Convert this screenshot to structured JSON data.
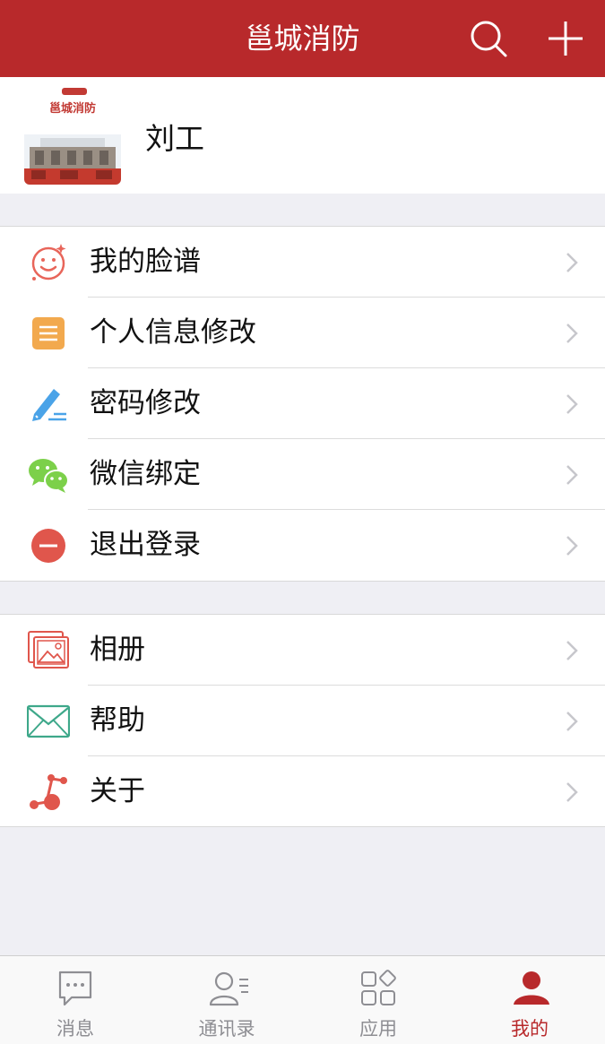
{
  "header": {
    "title": "邕城消防",
    "search_icon": "search-icon",
    "add_icon": "plus-icon",
    "background": "#b8292b"
  },
  "profile": {
    "avatar_label": "邕城消防",
    "name": "刘工"
  },
  "menu_group_1": [
    {
      "label": "我的脸谱",
      "icon": "smiley-face-icon",
      "color": "#e8655a"
    },
    {
      "label": "个人信息修改",
      "icon": "document-icon",
      "color": "#f2a94e"
    },
    {
      "label": "密码修改",
      "icon": "pencil-icon",
      "color": "#4aa3e8"
    },
    {
      "label": "微信绑定",
      "icon": "wechat-icon",
      "color": "#7cd04a"
    },
    {
      "label": "退出登录",
      "icon": "minus-circle-icon",
      "color": "#e0564c"
    }
  ],
  "menu_group_2": [
    {
      "label": "相册",
      "icon": "photo-album-icon",
      "color": "#e0564c"
    },
    {
      "label": "帮助",
      "icon": "envelope-icon",
      "color": "#3ea88a"
    },
    {
      "label": "关于",
      "icon": "share-nodes-icon",
      "color": "#e0564c"
    }
  ],
  "tabbar": {
    "tabs": [
      {
        "label": "消息",
        "icon": "chat-bubble-icon"
      },
      {
        "label": "通讯录",
        "icon": "contacts-icon"
      },
      {
        "label": "应用",
        "icon": "apps-grid-icon"
      },
      {
        "label": "我的",
        "icon": "person-icon"
      }
    ],
    "active_color": "#b8292b",
    "inactive_color": "#8e8e93"
  }
}
